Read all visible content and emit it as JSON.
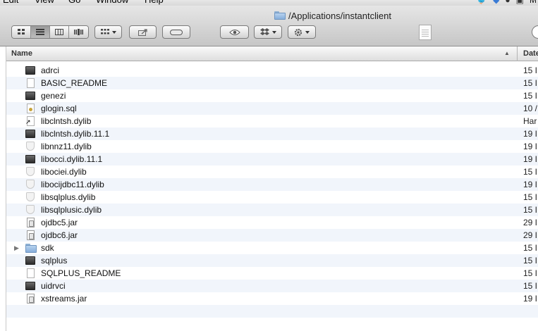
{
  "menubar": {
    "items": [
      "Edit",
      "View",
      "Go",
      "Window",
      "Help"
    ],
    "status_text": "M"
  },
  "window": {
    "title": "/Applications/instantclient"
  },
  "columns": {
    "name": "Name",
    "date": "Date"
  },
  "files": [
    {
      "name": "adrci",
      "icon": "exec",
      "date": "15 I"
    },
    {
      "name": "BASIC_README",
      "icon": "doc",
      "date": "15 I"
    },
    {
      "name": "genezi",
      "icon": "exec",
      "date": "15 I"
    },
    {
      "name": "glogin.sql",
      "icon": "script",
      "date": "10 /"
    },
    {
      "name": "libclntsh.dylib",
      "icon": "alias",
      "date": "Har"
    },
    {
      "name": "libclntsh.dylib.11.1",
      "icon": "exec",
      "date": "19 I"
    },
    {
      "name": "libnnz11.dylib",
      "icon": "dylib",
      "date": "19 I"
    },
    {
      "name": "libocci.dylib.11.1",
      "icon": "exec",
      "date": "19 I"
    },
    {
      "name": "libociei.dylib",
      "icon": "dylib",
      "date": "15 I"
    },
    {
      "name": "libocijdbc11.dylib",
      "icon": "dylib",
      "date": "19 I"
    },
    {
      "name": "libsqlplus.dylib",
      "icon": "dylib",
      "date": "15 I"
    },
    {
      "name": "libsqlplusic.dylib",
      "icon": "dylib",
      "date": "15 I"
    },
    {
      "name": "ojdbc5.jar",
      "icon": "jar",
      "date": "29 I"
    },
    {
      "name": "ojdbc6.jar",
      "icon": "jar",
      "date": "29 I"
    },
    {
      "name": "sdk",
      "icon": "folder",
      "date": "15 I",
      "expandable": true
    },
    {
      "name": "sqlplus",
      "icon": "exec",
      "date": "15 I"
    },
    {
      "name": "SQLPLUS_README",
      "icon": "doc",
      "date": "15 I"
    },
    {
      "name": "uidrvci",
      "icon": "exec",
      "date": "15 I"
    },
    {
      "name": "xstreams.jar",
      "icon": "jar",
      "date": "19 I"
    }
  ],
  "colors": {
    "row_alt": "#f1f5fb",
    "toolbar_top": "#e6e6e6",
    "toolbar_bottom": "#c6c6c6"
  }
}
